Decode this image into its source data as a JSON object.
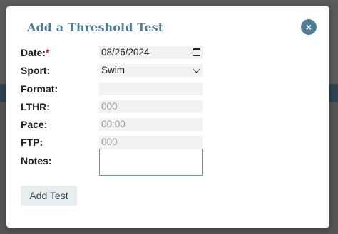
{
  "dialog": {
    "title": "Add a Threshold Test",
    "close_glyph": "×"
  },
  "fields": {
    "date": {
      "label": "Date:",
      "required_mark": "*",
      "value": "08/26/2024"
    },
    "sport": {
      "label": "Sport:",
      "value": "Swim"
    },
    "format": {
      "label": "Format:",
      "value": ""
    },
    "lthr": {
      "label": "LTHR:",
      "placeholder": "000"
    },
    "pace": {
      "label": "Pace:",
      "placeholder": "00:00"
    },
    "ftp": {
      "label": "FTP:",
      "placeholder": "000"
    },
    "notes": {
      "label": "Notes:",
      "value": ""
    }
  },
  "actions": {
    "submit_label": "Add Test"
  },
  "colors": {
    "accent": "#4f7d95",
    "required": "#cc2222",
    "field_bg": "#f2f2f2",
    "button_bg": "#e8edf0"
  }
}
